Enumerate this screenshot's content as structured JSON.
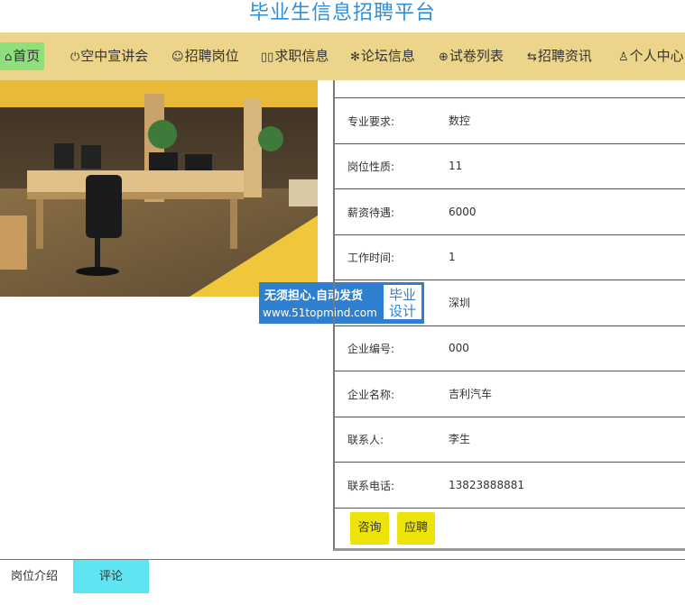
{
  "site": {
    "title": "毕业生信息招聘平台"
  },
  "nav": {
    "items": [
      {
        "icon": "⌂",
        "label": "首页",
        "active": true
      },
      {
        "icon": "⏻",
        "label": "空中宣讲会"
      },
      {
        "icon": "☺",
        "label": "招聘岗位"
      },
      {
        "icon": "▯▯",
        "label": "求职信息"
      },
      {
        "icon": "✻",
        "label": "论坛信息"
      },
      {
        "icon": "⊕",
        "label": "试卷列表"
      },
      {
        "icon": "⇆",
        "label": "招聘资讯"
      },
      {
        "icon": "♙",
        "label": "个人中心"
      }
    ]
  },
  "watermark": {
    "line1": "无须担心.自动发货",
    "line2": "www.51topmind.com",
    "box_line1": "毕业",
    "box_line2": "设计"
  },
  "details": {
    "rows": [
      {
        "label": "专业要求:",
        "value": "数控"
      },
      {
        "label": "岗位性质:",
        "value": "11"
      },
      {
        "label": "薪资待遇:",
        "value": "6000"
      },
      {
        "label": "工作时间:",
        "value": "1"
      },
      {
        "label": "",
        "value": "深圳"
      },
      {
        "label": "企业编号:",
        "value": "000"
      },
      {
        "label": "企业名称:",
        "value": "吉利汽车"
      },
      {
        "label": "联系人:",
        "value": "李生"
      },
      {
        "label": "联系电话:",
        "value": "13823888881"
      }
    ]
  },
  "actions": {
    "consult": "咨询",
    "apply": "应聘"
  },
  "tabs": [
    {
      "label": "岗位介绍"
    },
    {
      "label": "评论",
      "active": true
    }
  ],
  "colors": {
    "title": "#2f8fd8",
    "nav_bg": "#ecd58a",
    "nav_active": "#8fe07c",
    "button": "#ece30b",
    "tab_active": "#5ee5f1",
    "watermark": "#2e7fd0"
  }
}
